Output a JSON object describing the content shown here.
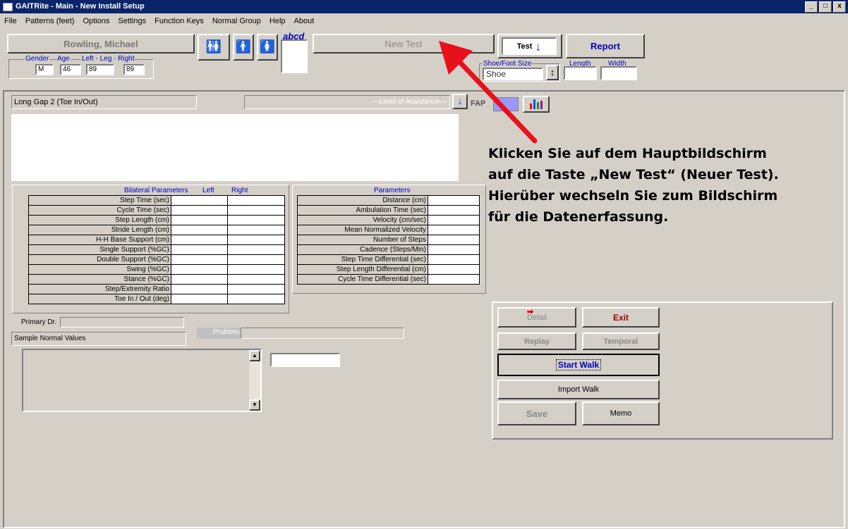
{
  "window": {
    "title": "GAITRite - Main - New Install Setup",
    "buttons": [
      "_",
      "□",
      "x"
    ]
  },
  "menu": [
    "File",
    "Patterns (feet)",
    "Options",
    "Settings",
    "Function Keys",
    "Normal Group",
    "Help",
    "About"
  ],
  "patient": {
    "name": "Rowling, Michael",
    "gender_label": "Gender",
    "age_label": "Age",
    "leg_label": "Left - Leg - Right",
    "gender": "M",
    "age": "46",
    "left_leg": "89",
    "right_leg": "89"
  },
  "abcd_label": "abcd",
  "new_test_label": "New Test",
  "test_label": "Test",
  "report_label": "Report",
  "shoe": {
    "size_label": "Shoe/Foot Size",
    "value": "Shoe",
    "length_label": "Length",
    "width_label": "Width"
  },
  "pattern_name": "Long Gap 2 (Toe In/Out)",
  "assistance_label": "—Level of Assistance—",
  "fap_label": "FAP",
  "bilateral": {
    "header": "Bilateral Parameters",
    "left_label": "Left",
    "right_label": "Right",
    "rows": [
      "Step Time (sec)",
      "Cycle Time (sec)",
      "Step Length (cm)",
      "Stride Length (cm)",
      "H-H Base Support (cm)",
      "Single Support (%GC)",
      "Double Support (%GC)",
      "Swing (%GC)",
      "Stance (%GC)",
      "Step/Extremity Ratio",
      "Toe In / Out (deg)"
    ]
  },
  "parameters": {
    "header": "Parameters",
    "rows": [
      "Distance (cm)",
      "Ambulation Time (sec)",
      "Velocity (cm/sec)",
      "Mean Normalized Velocity",
      "Number of Steps",
      "Cadence (Steps/Min)",
      "Step Time Differential (sec)",
      "Step Length Differential (cm)",
      "Cycle Time Differential (sec)"
    ]
  },
  "primary_dr_label": "Primary Dr.",
  "problem_label": "Problem",
  "normal_values": "Sample Normal Values",
  "actions": {
    "detail": "Detail",
    "exit": "Exit",
    "replay": "Replay",
    "temporal": "Temporal",
    "start_walk": "Start Walk",
    "import_walk": "Import Walk",
    "save": "Save",
    "memo": "Memo"
  },
  "annotation": {
    "line1": "Klicken Sie auf dem Hauptbildschirm",
    "line2": "auf die Taste „New Test“ (Neuer Test).",
    "line3": "Hierüber wechseln Sie zum Bildschirm",
    "line4": "für die Datenerfassung."
  },
  "colors": {
    "titlebar": "#0a246a",
    "face": "#d4d0c8",
    "label_blue": "#0000c0",
    "arrow_red": "#e8101a",
    "fap_box": "#9999ff",
    "exit_red": "#990000"
  }
}
